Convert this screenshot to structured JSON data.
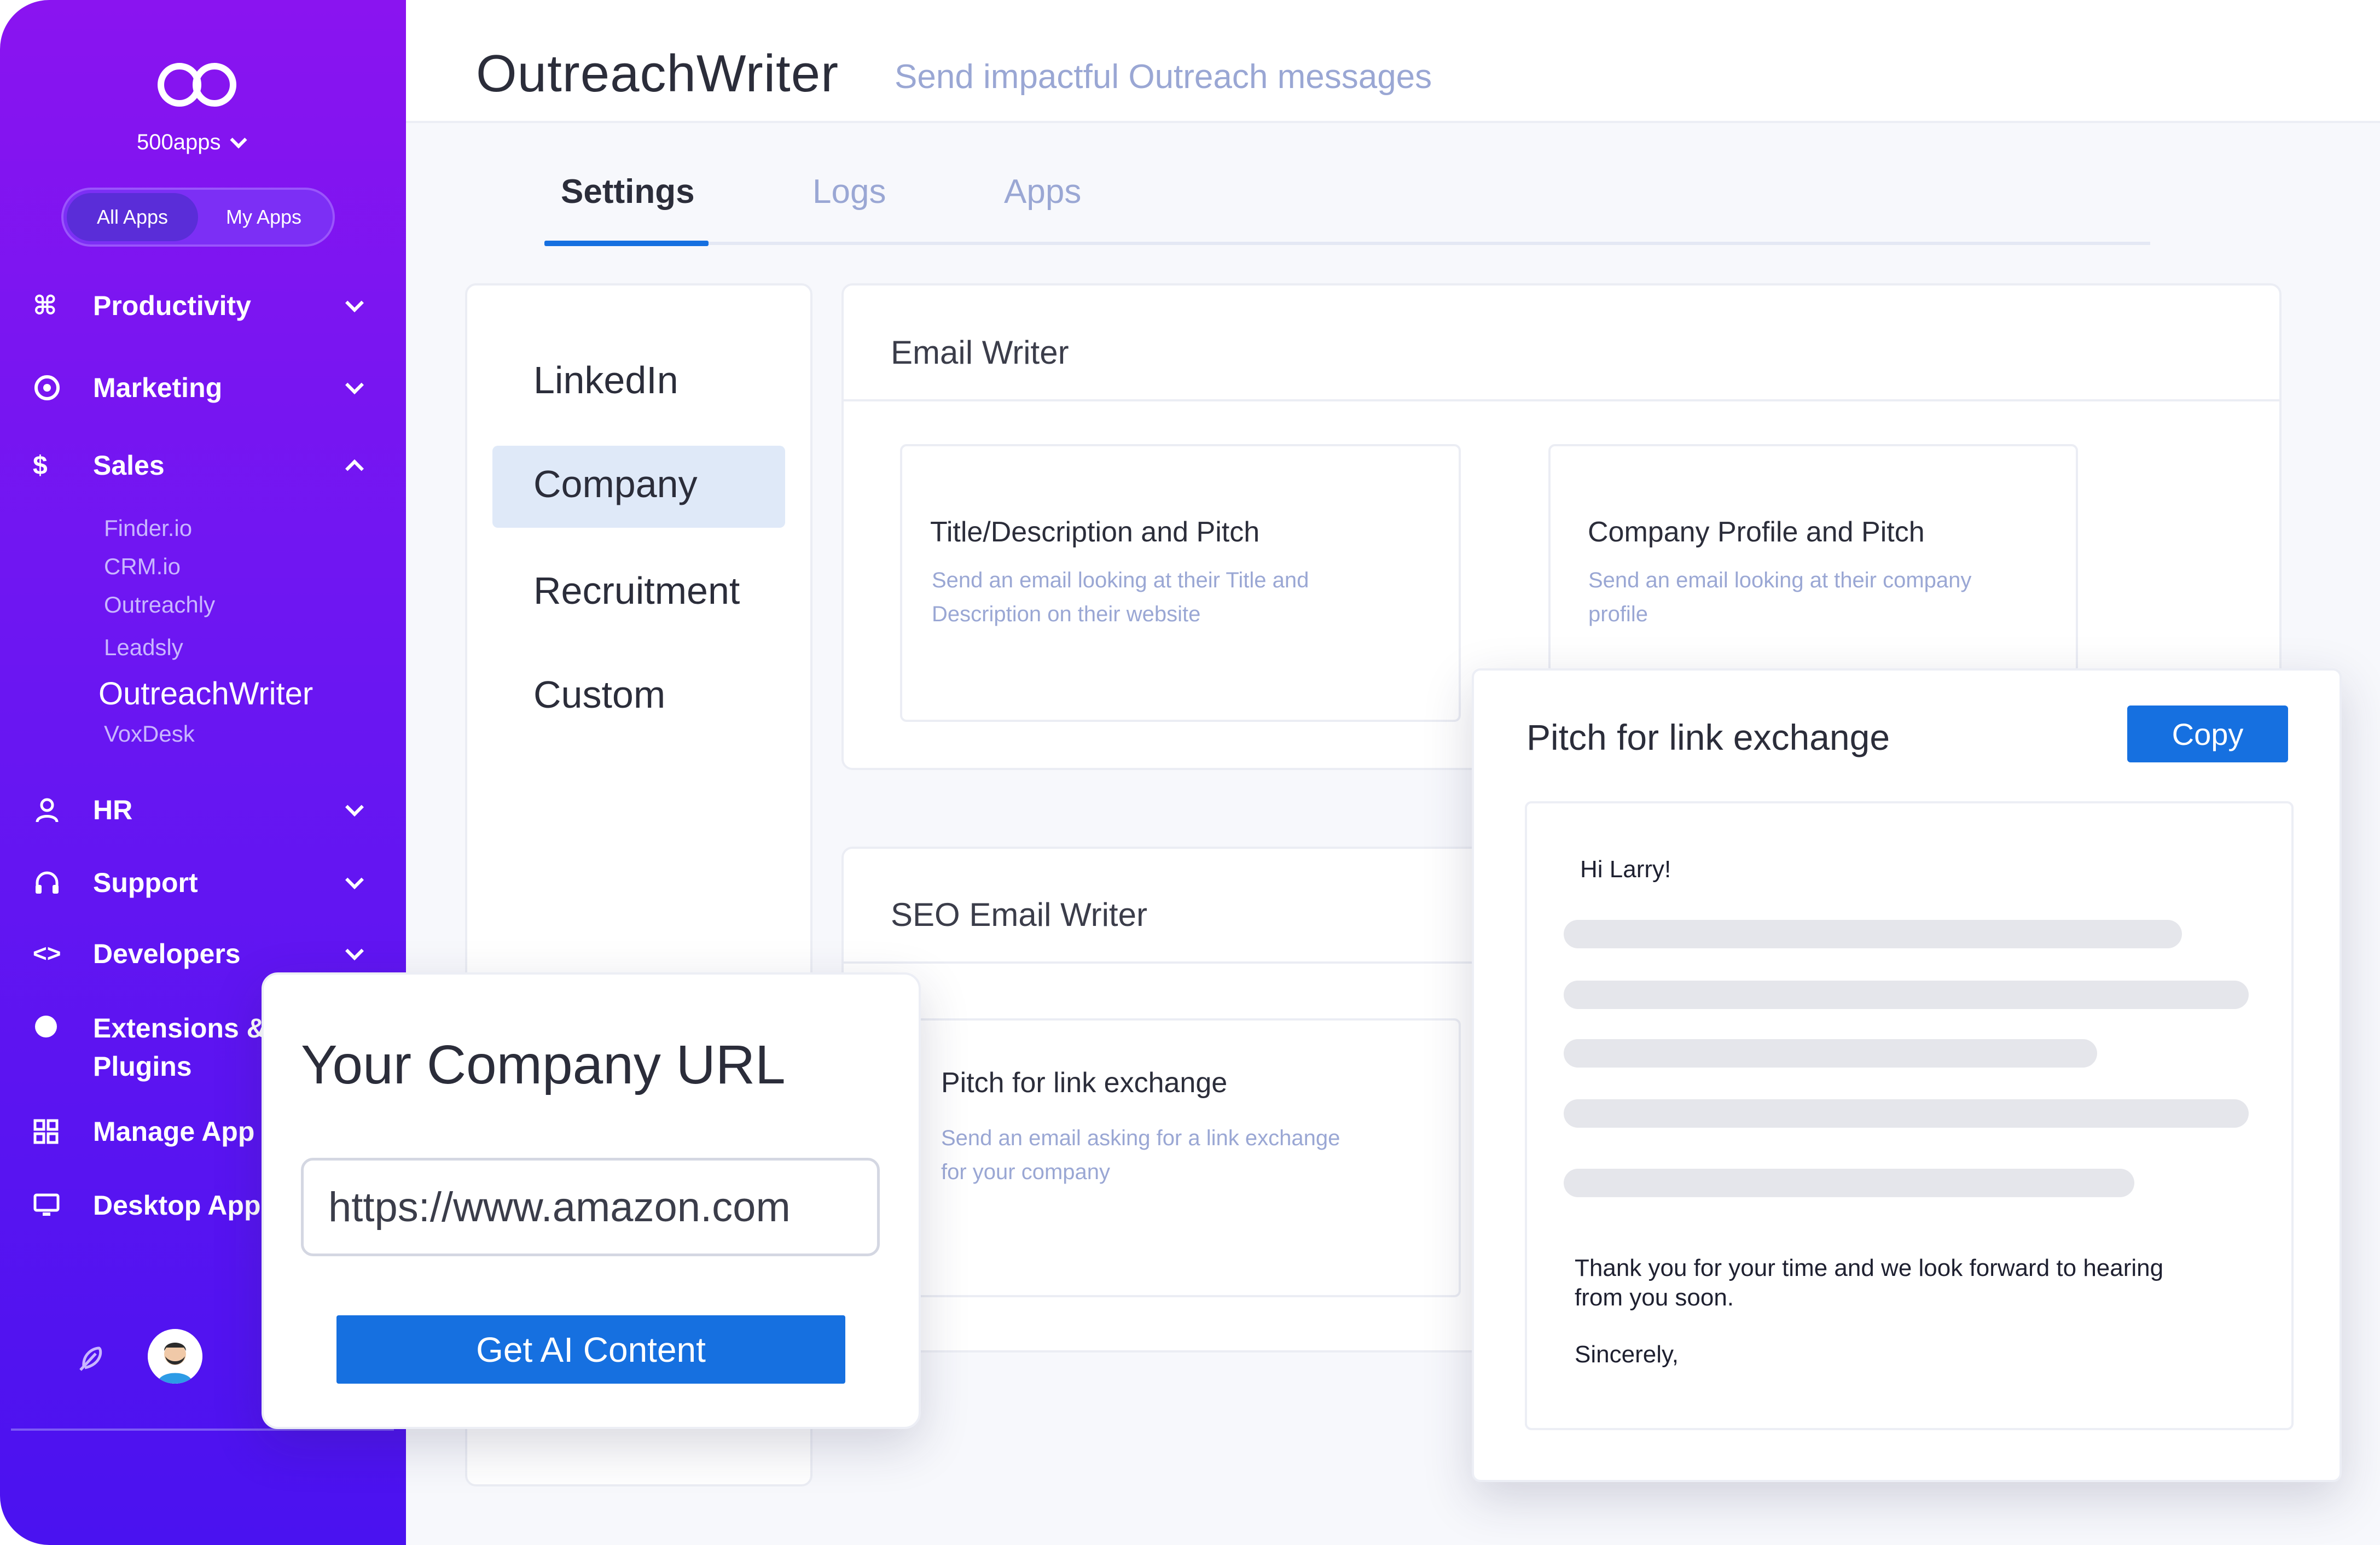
{
  "sidebar": {
    "workspace": "500apps",
    "toggle": {
      "all_apps": "All Apps",
      "my_apps": "My Apps"
    },
    "nav": [
      {
        "label": "Productivity",
        "icon": "command-icon"
      },
      {
        "label": "Marketing",
        "icon": "target-icon"
      },
      {
        "label": "Sales",
        "icon": "dollar-icon"
      },
      {
        "label": "HR",
        "icon": "person-icon"
      },
      {
        "label": "Support",
        "icon": "headphones-icon"
      },
      {
        "label": "Developers",
        "icon": "code-icon"
      },
      {
        "label": "Extensions & Plugins",
        "label_line1": "Extensions &",
        "label_line2": "Plugins",
        "icon": "puzzle-icon"
      },
      {
        "label": "Manage Apps",
        "label_visible": "Manage App",
        "icon": "grid-icon"
      },
      {
        "label": "Desktop Apps",
        "label_visible": "Desktop App",
        "icon": "monitor-icon"
      }
    ],
    "sales_sub": [
      "Finder.io",
      "CRM.io",
      "Outreachly",
      "Leadsly",
      "OutreachWriter",
      "VoxDesk"
    ]
  },
  "header": {
    "title": "OutreachWriter",
    "subtitle": "Send impactful Outreach messages"
  },
  "tabs": [
    "Settings",
    "Logs",
    "Apps"
  ],
  "categories": [
    "LinkedIn",
    "Company",
    "Recruitment",
    "Custom"
  ],
  "email_writer": {
    "title": "Email Writer",
    "cards": [
      {
        "title": "Title/Description and Pitch",
        "desc1": "Send an email looking at their Title and",
        "desc2": "Description on their website"
      },
      {
        "title": "Company Profile and Pitch",
        "desc1": "Send an email looking at their company",
        "desc2": "profile"
      }
    ]
  },
  "seo_writer": {
    "title": "SEO Email Writer",
    "card": {
      "title": "Pitch for link exchange",
      "desc1": "Send an email asking for a link exchange",
      "desc2": "for your company"
    }
  },
  "result_popup": {
    "title": "Pitch for link exchange",
    "copy_label": "Copy",
    "greeting": "Hi Larry!",
    "closing1": "Thank you for your time and we look forward to hearing",
    "closing2": "from you soon.",
    "signoff": "Sincerely,"
  },
  "url_popup": {
    "title": "Your Company URL",
    "url_value": "https://www.amazon.com",
    "button": "Get AI Content"
  },
  "colors": {
    "accent": "#1670e0",
    "sidebar_top": "#8a14f0",
    "sidebar_bottom": "#4a12f0",
    "muted_text": "#9aa7d4"
  }
}
